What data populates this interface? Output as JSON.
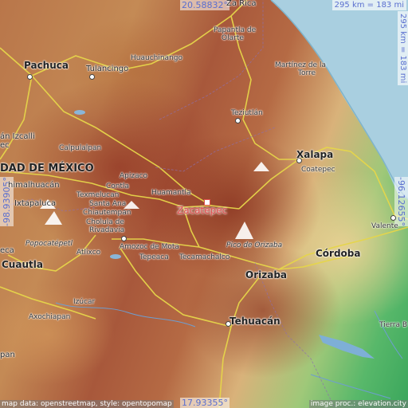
{
  "target": {
    "name": "Zacatepec",
    "color": "#e05050"
  },
  "coordinates": {
    "top_lat": "20.58832°",
    "bottom_lat": "17.93355°",
    "left_lon": "-98.93905°",
    "right_lon": "-96.12655°"
  },
  "scale": {
    "horizontal": "295 km = 183 mi",
    "vertical": "295 km = 183 mi"
  },
  "credits": {
    "left": "map data: openstreetmap, style: opentopomap",
    "right": "image proc.: elevation.city"
  },
  "cities": {
    "za_rica": "Za Rica",
    "papantla": "Papantla de",
    "olarte": "Olarte",
    "pachuca": "Pachuca",
    "tulancingo": "Tulancingo",
    "huauchinango": "Huauchinango",
    "martinez_1": "Martínez de la",
    "martinez_2": "Torre",
    "teziutlan": "Teziutlán",
    "izcalli_1": "án Izcalli",
    "izcalli_2": "ec",
    "calpulalpan": "Calpulalpan",
    "xalapa": "Xalapa",
    "coatepec": "Coatepec",
    "mexico": "DAD DE MÉXICO",
    "apizaco": "Apizaco",
    "contla": "Contla",
    "chimalhuacan": "himalhuacán",
    "texmelucan": "Texmelucan",
    "huamantla": "Huamantla",
    "santa_ana": "Santa Ana",
    "chiautempan": "Chiautempan",
    "ixtapaluca": "Ixtapaluca",
    "cholula_1": "Cholula de",
    "cholula_2": "Rivadavia",
    "valente": "Valente",
    "popocatepetl": "Popocatépetl",
    "atlixco": "Atlixco",
    "amozoc": "Amozoc de Mota",
    "tepeaca": "Tepeaca",
    "tecamachalco": "Tecamachalco",
    "pico_orizaba": "Pico de Orizaba",
    "cordoba": "Córdoba",
    "tlalpan_left": "eca",
    "cuautla": "Cuautla",
    "orizaba": "Orizaba",
    "izucar": "Izúcar",
    "axochiapan": "Axochiapan",
    "tehuacan": "Tehuacán",
    "tierra_blanca": "Tierra B",
    "pan_left": "pan"
  }
}
